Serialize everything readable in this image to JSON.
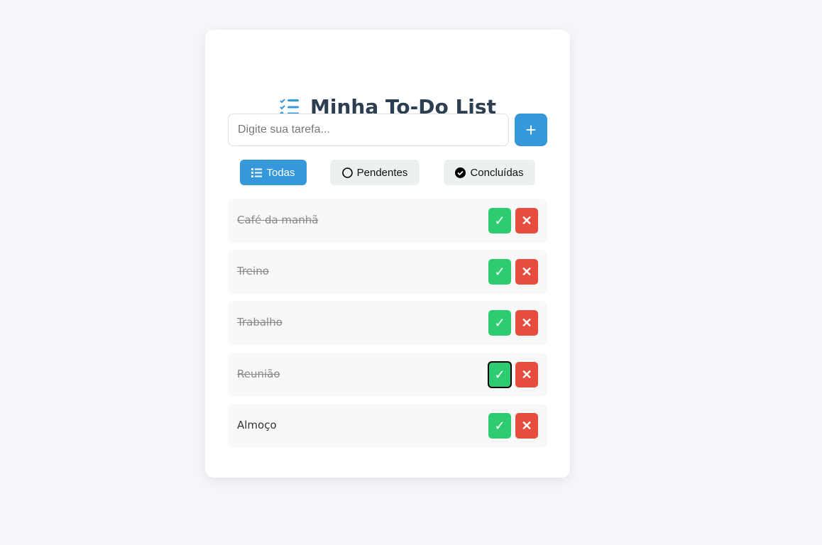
{
  "title": "Minha To-Do List",
  "input": {
    "placeholder": "Digite sua tarefa...",
    "value": ""
  },
  "add_label": "+",
  "filters": [
    {
      "label": "Todas",
      "active": true
    },
    {
      "label": "Pendentes"
    },
    {
      "label": "Concluídas"
    }
  ],
  "tasks": [
    {
      "text": "Café da manhã",
      "done": true
    },
    {
      "text": "Treino",
      "done": true
    },
    {
      "text": "Trabalho",
      "done": true
    },
    {
      "text": "Reunião",
      "done": true
    },
    {
      "text": "Almoço",
      "done": false
    }
  ],
  "icons": {
    "check": "✓",
    "delete": "✕"
  },
  "colors": {
    "accent": "#3498db",
    "success": "#2ecc71",
    "danger": "#e74c3c"
  }
}
